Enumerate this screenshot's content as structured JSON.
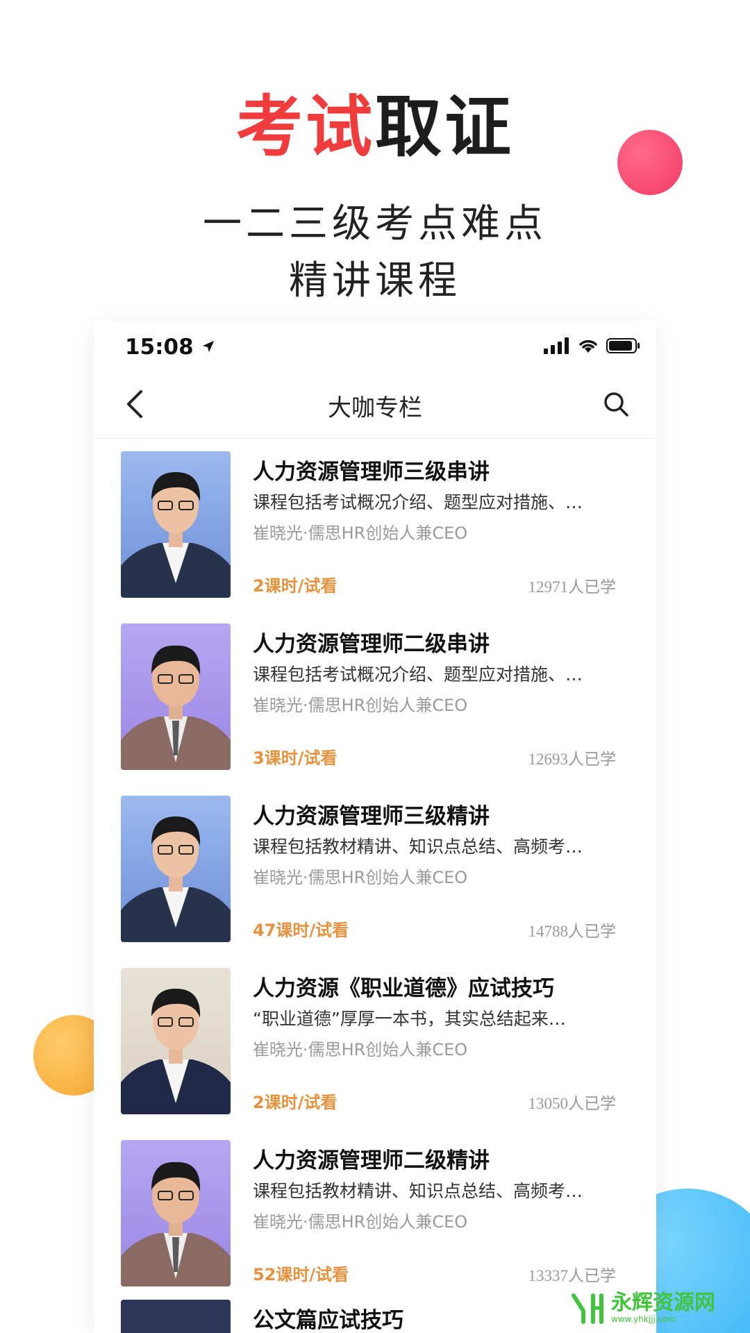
{
  "headline": {
    "part_red": "考试",
    "part_dark": "取证"
  },
  "subtitle": {
    "line1": "一二三级考点难点",
    "line2": "精讲课程"
  },
  "status_bar": {
    "time": "15:08"
  },
  "nav": {
    "title": "大咖专栏"
  },
  "courses": [
    {
      "title": "人力资源管理师三级串讲",
      "desc": "课程包括考试概况介绍、题型应对措施、…",
      "author": "崔晓光·儒思HR创始人兼CEO",
      "lessons": "2课时/试看",
      "learners": "12971人已学"
    },
    {
      "title": "人力资源管理师二级串讲",
      "desc": "课程包括考试概况介绍、题型应对措施、…",
      "author": "崔晓光·儒思HR创始人兼CEO",
      "lessons": "3课时/试看",
      "learners": "12693人已学"
    },
    {
      "title": "人力资源管理师三级精讲",
      "desc": "课程包括教材精讲、知识点总结、高频考…",
      "author": "崔晓光·儒思HR创始人兼CEO",
      "lessons": "47课时/试看",
      "learners": "14788人已学"
    },
    {
      "title": "人力资源《职业道德》应试技巧",
      "desc": "“职业道德”厚厚一本书，其实总结起来…",
      "author": "崔晓光·儒思HR创始人兼CEO",
      "lessons": "2课时/试看",
      "learners": "13050人已学"
    },
    {
      "title": "人力资源管理师二级精讲",
      "desc": "课程包括教材精讲、知识点总结、高频考…",
      "author": "崔晓光·儒思HR创始人兼CEO",
      "lessons": "52课时/试看",
      "learners": "13337人已学"
    },
    {
      "title": "公文篇应试技巧"
    }
  ],
  "watermark": {
    "name": "永辉资源网",
    "url": "www.yhkjjj.com"
  },
  "colors": {
    "accent_red": "#f03c3c",
    "lesson_orange": "#e8913c",
    "watermark_green": "#42c33c"
  },
  "icons": [
    "back-icon",
    "search-icon",
    "location-arrow-icon",
    "signal-icon",
    "wifi-icon",
    "battery-icon"
  ]
}
